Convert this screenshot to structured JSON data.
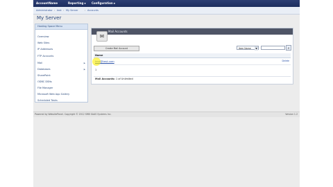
{
  "topnav": {
    "items": [
      {
        "label": "AccountName"
      },
      {
        "label": "Reporting"
      },
      {
        "label": "Configuration"
      }
    ]
  },
  "breadcrumb": {
    "items": [
      "Administrator",
      "test",
      "My Server",
      "Accounts"
    ]
  },
  "page_title": "My Server",
  "sidebar": {
    "header": "Hosting Space Menu",
    "items": [
      {
        "label": "Overview"
      },
      {
        "label": "Web Sites"
      },
      {
        "label": "IP Addresses"
      },
      {
        "label": "FTP Accounts"
      },
      {
        "label": "Mail"
      },
      {
        "label": "Databases"
      },
      {
        "label": "SharePoint"
      },
      {
        "label": "ODBC DSNs"
      },
      {
        "label": "File Manager"
      },
      {
        "label": "Microsoft Web App Gallery"
      },
      {
        "label": "Scheduled Tasks"
      }
    ]
  },
  "panel": {
    "title": "Mail Accounts",
    "create_button": "Create Mail Account",
    "filter_select": "Item Name",
    "table": {
      "header": "Name",
      "rows": [
        {
          "name": "test@test.com",
          "action": "Delete"
        }
      ]
    },
    "pager": "1",
    "summary_label": "Mail Accounts:",
    "summary_value": "1 of Unlimited"
  },
  "footer": {
    "copyright": "Powered by WebsitePanel. Copyright © 2012 SMB SAAS Systems Inc.",
    "version": "Version 1.2"
  }
}
